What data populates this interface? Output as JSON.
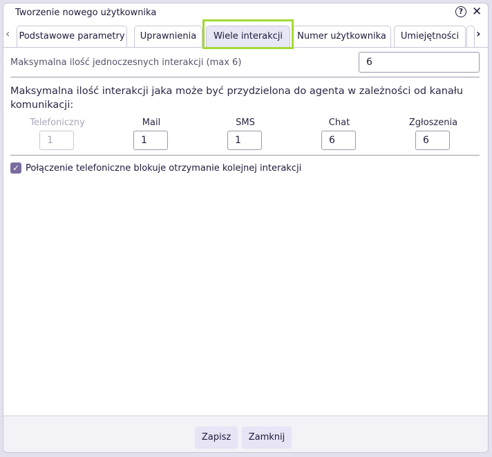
{
  "dialog": {
    "title": "Tworzenie nowego użytkownika",
    "help_icon": "?",
    "close_icon": "✕"
  },
  "tabs": [
    {
      "label": "Podstawowe parametry",
      "active": false
    },
    {
      "label": "Uprawnienia",
      "active": false
    },
    {
      "label": "Wiele interakcji",
      "active": true
    },
    {
      "label": "Numer użytkownika",
      "active": false
    },
    {
      "label": "Umiejętności",
      "active": false
    },
    {
      "label": "",
      "active": false
    }
  ],
  "tab_nav": {
    "prev": "‹",
    "next": "›"
  },
  "max_simultaneous": {
    "label": "Maksymalna ilość jednoczesnych interakcji (max 6)",
    "value": "6"
  },
  "channels_section": {
    "description": "Maksymalna ilość interakcji jaka może być przydzielona do agenta w zależności od kanału komunikacji:",
    "channels": [
      {
        "label": "Telefoniczny",
        "value": "1",
        "disabled": true
      },
      {
        "label": "Mail",
        "value": "1",
        "disabled": false
      },
      {
        "label": "SMS",
        "value": "1",
        "disabled": false
      },
      {
        "label": "Chat",
        "value": "6",
        "disabled": false
      },
      {
        "label": "Zgłoszenia",
        "value": "6",
        "disabled": false
      }
    ]
  },
  "phone_blocks_checkbox": {
    "checked": true,
    "label": "Połączenie telefoniczne blokuje otrzymanie kolejnej interakcji"
  },
  "footer": {
    "save_label": "Zapisz",
    "close_label": "Zamknij"
  },
  "colors": {
    "accent_highlight": "#a3d935",
    "checkbox": "#7a6c9e",
    "button_bg": "#e6e4f5"
  }
}
